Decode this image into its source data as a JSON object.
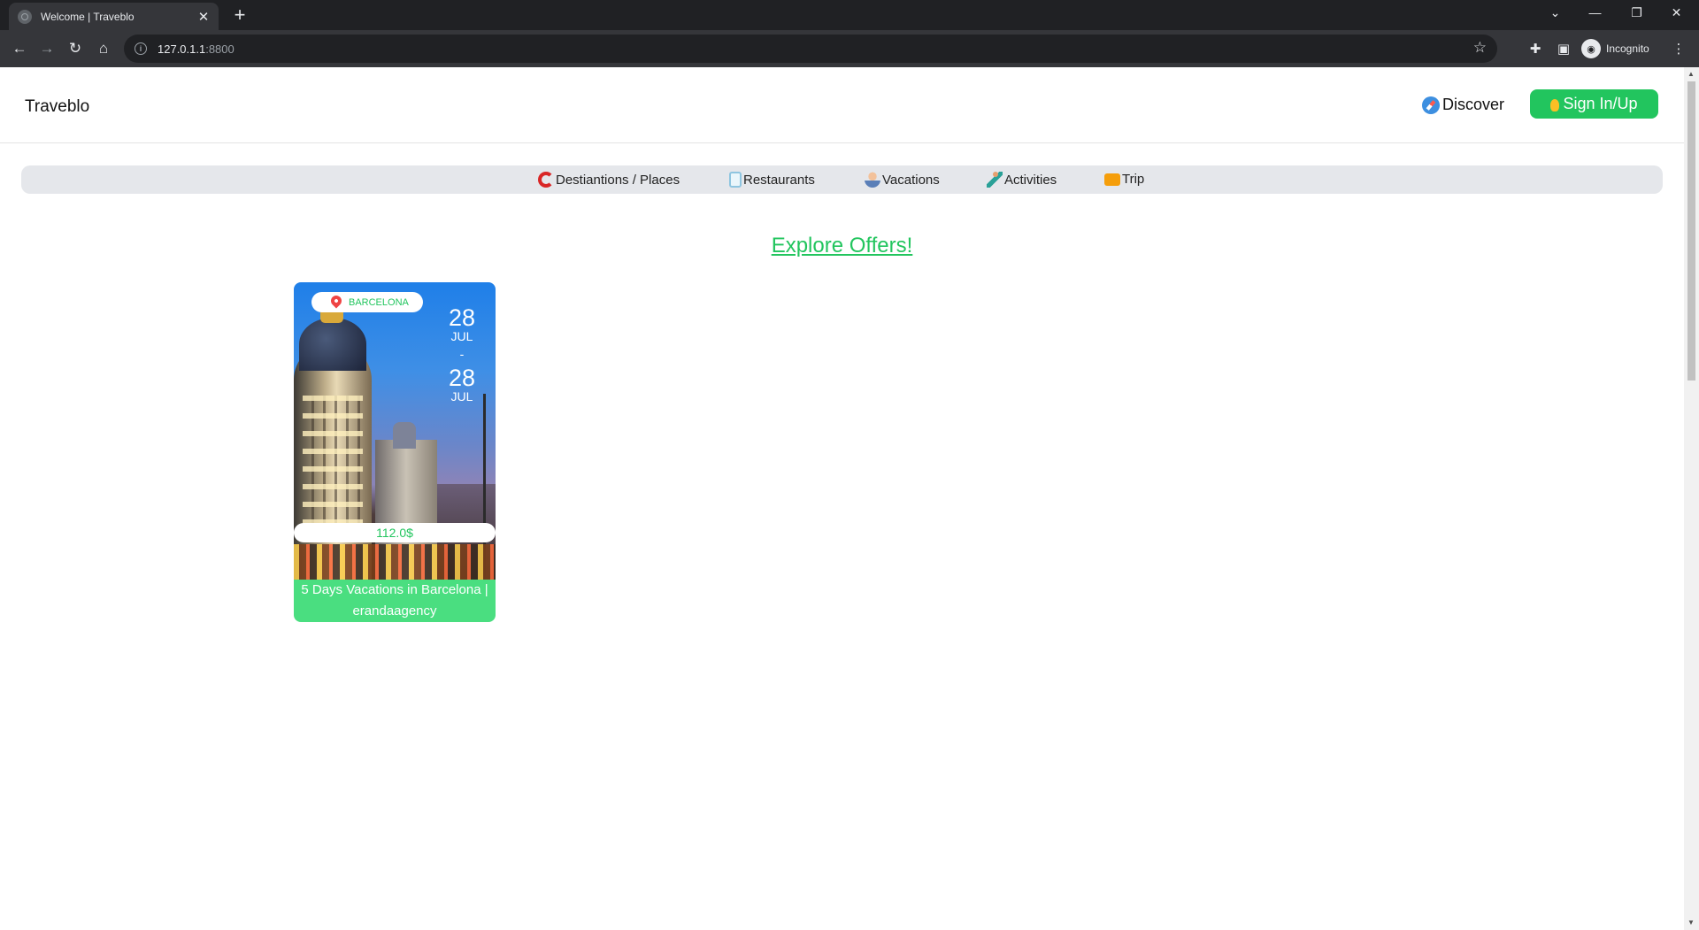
{
  "browser": {
    "tab_title": "Welcome | Traveblo",
    "url_host": "127.0.1.1",
    "url_port": ":8800",
    "profile_label": "Incognito"
  },
  "header": {
    "brand": "Traveblo",
    "discover_label": "Discover",
    "signin_label": "Sign In/Up"
  },
  "categories": [
    {
      "label": "Destiantions / Places",
      "icon": "target-icon"
    },
    {
      "label": "Restaurants",
      "icon": "menu-card-icon"
    },
    {
      "label": "Vacations",
      "icon": "person-icon"
    },
    {
      "label": "Activities",
      "icon": "runner-icon"
    },
    {
      "label": "Trip",
      "icon": "briefcase-icon"
    }
  ],
  "main": {
    "heading": "Explore Offers!"
  },
  "offers": [
    {
      "location": "BARCELONA",
      "start_day": "28",
      "start_month": "JUL",
      "separator": "-",
      "end_day": "28",
      "end_month": "JUL",
      "price": "112.0$",
      "title": "5 Days Vacations in Barcelona | erandaagency"
    }
  ],
  "colors": {
    "accent": "#22c55e",
    "caption_bg": "#4ade80",
    "category_bar": "#e5e7eb"
  }
}
